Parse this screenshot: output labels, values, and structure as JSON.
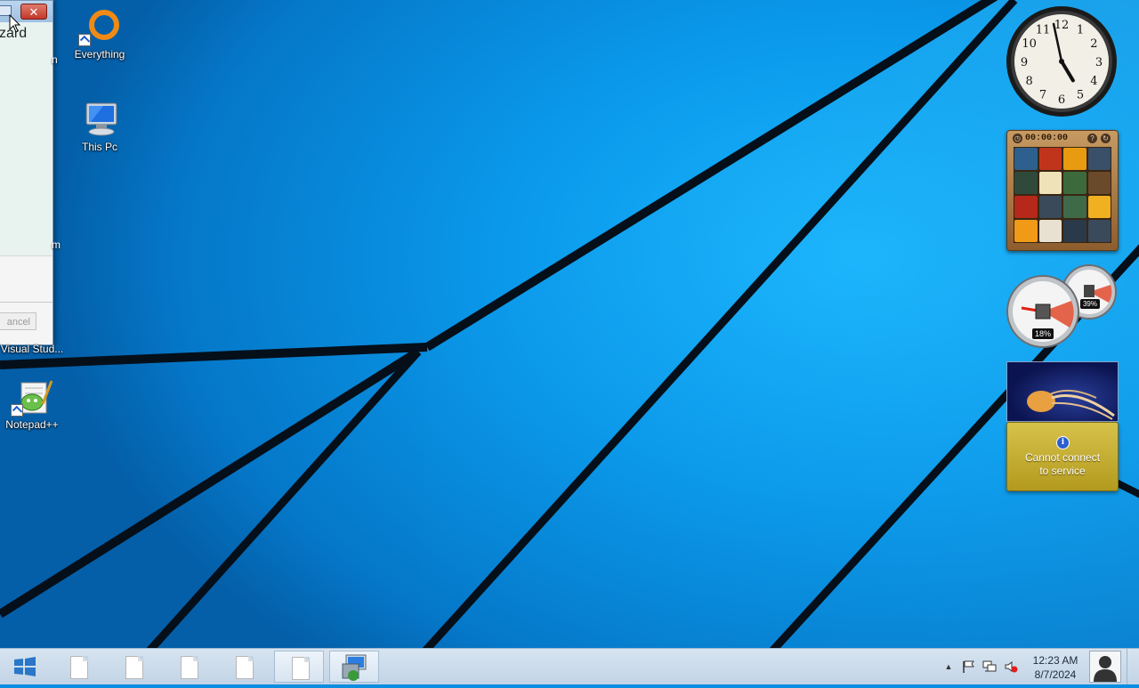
{
  "desktop": {
    "icons": [
      {
        "label": "Everything",
        "icon": "everything-icon"
      },
      {
        "label": "This Pc",
        "icon": "computer-icon"
      },
      {
        "label": "Visual Stud...",
        "icon": "visual-studio-icon"
      },
      {
        "label": "Notepad++",
        "icon": "notepad-plus-plus-icon"
      }
    ],
    "partial_labels": [
      "n",
      "m"
    ]
  },
  "wizard": {
    "title_fragment": "zard",
    "cancel_label": "ancel",
    "close_glyph": "✕"
  },
  "gadgets": {
    "clock": {
      "hour": 4,
      "minute": 58,
      "numerals": [
        "12",
        "1",
        "2",
        "3",
        "4",
        "5",
        "6",
        "7",
        "8",
        "9",
        "10",
        "11"
      ]
    },
    "puzzle": {
      "timer": "00:00:00",
      "tiles": [
        "#2d5f8f",
        "#c0341c",
        "#e89a10",
        "#3a4f6a",
        "#2f4a3a",
        "#f0e2b8",
        "#3c6a3c",
        "#6a4a2a",
        "#b5281a",
        "#3a4a5a",
        "#3f6a4a",
        "#f0b020",
        "#f09a18",
        "#e8e0d0",
        "#2a3a4a",
        "#3a4a5a"
      ]
    },
    "cpu_meter": {
      "cpu_percent": "18%",
      "memory_percent": "39%"
    },
    "weather": {
      "message_line1": "Cannot connect",
      "message_line2": "to service"
    }
  },
  "taskbar": {
    "pinned_items": [
      "page",
      "page",
      "page",
      "page",
      "page",
      "remote"
    ],
    "clock_time": "12:23 AM",
    "clock_date": "8/7/2024",
    "colors": {
      "accent": "#0a98ea",
      "taskbar": "#c9dae9"
    }
  }
}
